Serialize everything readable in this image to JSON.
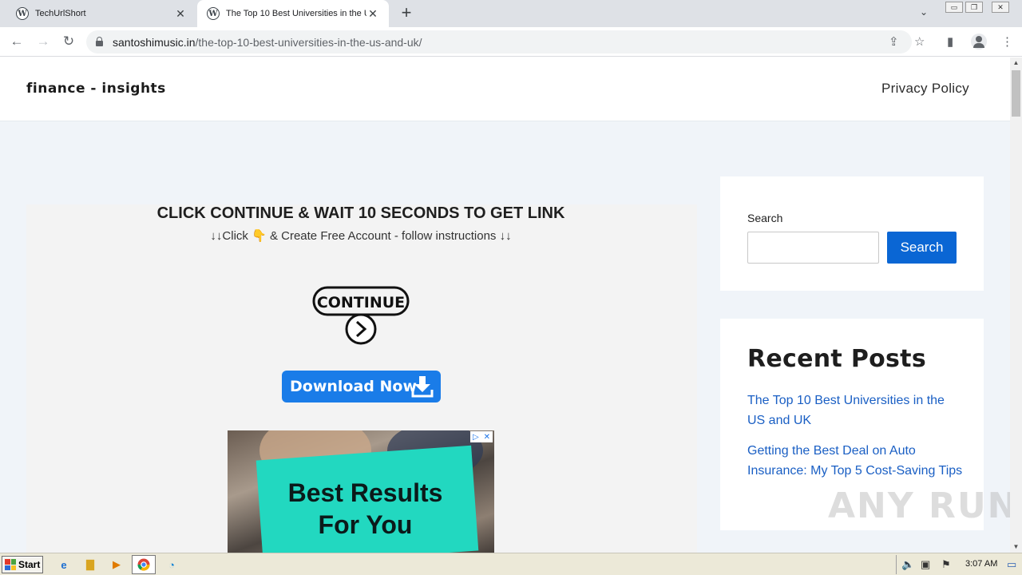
{
  "browser": {
    "tabs": [
      {
        "title": "TechUrlShort",
        "active": false
      },
      {
        "title": "The Top 10 Best Universities in the U",
        "active": true
      }
    ],
    "url_host": "santoshimusic.in",
    "url_path": "/the-top-10-best-universities-in-the-us-and-uk/"
  },
  "site": {
    "title": "finance - insights",
    "nav": [
      "Privacy Policy"
    ]
  },
  "main": {
    "heading": "CLICK CONTINUE & WAIT 10 SECONDS TO GET LINK",
    "sub_prefix": "↓↓Click",
    "sub_hand": "👇",
    "sub_suffix": "& Create Free Account - follow instructions  ↓↓",
    "continue_label": "CONTINUE",
    "download_label": "Download Now",
    "ad_text_line1": "Best Results",
    "ad_text_line2": "For You"
  },
  "sidebar": {
    "search_label": "Search",
    "search_button": "Search",
    "search_value": "",
    "recent_title": "Recent Posts",
    "recent_posts": [
      "The Top 10 Best Universities in the US and UK",
      "Getting the Best Deal on Auto Insurance: My Top 5 Cost-Saving Tips"
    ]
  },
  "watermark": "ANY RUN",
  "taskbar": {
    "start_label": "Start",
    "clock": "3:07 AM"
  },
  "colors": {
    "accent_blue": "#0a66d4",
    "download_blue": "#1a7ce8",
    "ad_teal": "#22d8c0",
    "link_blue": "#1a5fc4",
    "page_bg": "#f0f4f9"
  }
}
